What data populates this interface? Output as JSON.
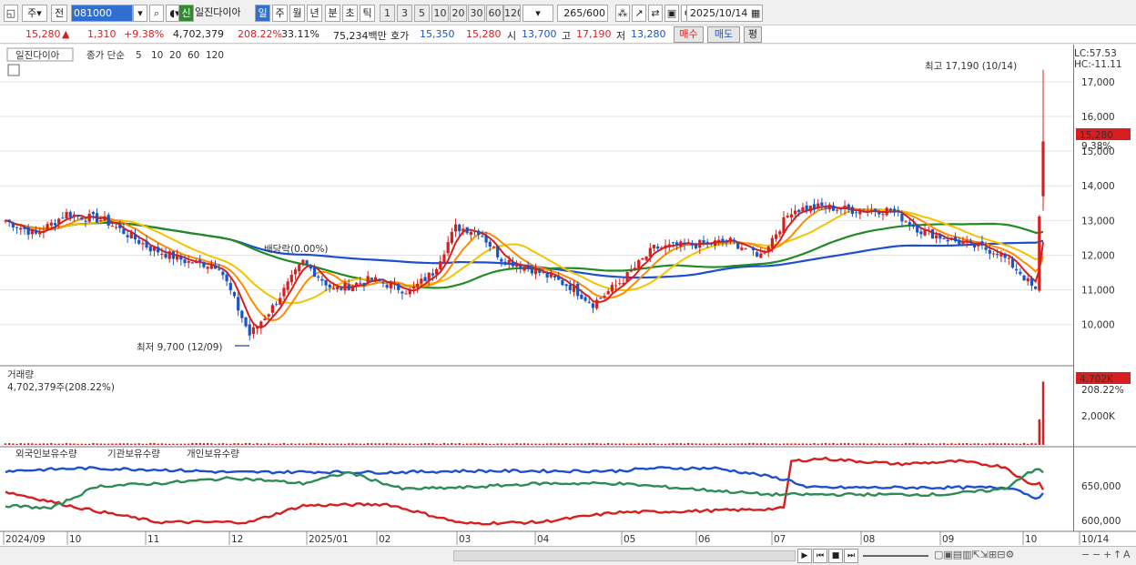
{
  "toolbar": {
    "market": "주",
    "prev": "전",
    "code": "081000",
    "name": "일진다이아",
    "periods": [
      "신",
      "일",
      "주",
      "월",
      "년",
      "분",
      "초",
      "틱"
    ],
    "active_period": "일",
    "intervals": [
      "1",
      "3",
      "5",
      "10",
      "20",
      "30",
      "60",
      "120"
    ],
    "count": "265",
    "total": "/600",
    "date": "2025/10/14"
  },
  "quote": {
    "price": "15,280",
    "arrow": "▲",
    "change": "1,310",
    "pct": "+9.38%",
    "volume": "4,702,379",
    "vol_ratio": "208.22%",
    "turnover": "33.11%",
    "amount": "75,234백만",
    "hoga_label": "호가",
    "hoga_sell": "15,350",
    "hoga_buy": "15,280",
    "open_label": "시",
    "open": "13,700",
    "high_label": "고",
    "high": "17,190",
    "low_label": "저",
    "low": "13,280",
    "buy_btn": "매수",
    "sell_btn": "매도",
    "eval_btn": "평"
  },
  "legend": {
    "name": "일진다이아",
    "ma_label": "종가 단순",
    "ma5": "5",
    "ma10": "10",
    "ma20": "20",
    "ma60": "60",
    "ma120": "120"
  },
  "annotations": {
    "high": "최고 17,190 (10/14)",
    "low": "최저 9,700 (12/09)",
    "dividend": "배당락(0.00%)",
    "lc": "LC:57.53",
    "hc": "HC:-11.11",
    "price_tag": "15,280",
    "price_pct": "9.38%"
  },
  "volume_panel": {
    "title": "거래량",
    "value": "4,702,379주(208.22%)",
    "tag": "4,702K",
    "tag_pct": "208.22%",
    "tick": "2,000K"
  },
  "holdings_panel": {
    "foreign": "외국인보유수량",
    "institution": "기관보유수량",
    "individual": "개인보유수량",
    "ticks": [
      "650,000",
      "600,000"
    ]
  },
  "x_labels": [
    "2024/09",
    "10",
    "11",
    "12",
    "2025/01",
    "02",
    "03",
    "04",
    "05",
    "06",
    "07",
    "08",
    "09",
    "10",
    "10/14"
  ],
  "chart_data": {
    "type": "candlestick",
    "y_ticks": [
      10000,
      11000,
      12000,
      13000,
      14000,
      15000,
      16000,
      17000
    ],
    "ylim": [
      9100,
      17600
    ],
    "anchors": [
      [
        0,
        13000
      ],
      [
        8,
        12600
      ],
      [
        16,
        13200
      ],
      [
        26,
        13000
      ],
      [
        38,
        12200
      ],
      [
        48,
        11800
      ],
      [
        56,
        11700
      ],
      [
        64,
        9700
      ],
      [
        70,
        10500
      ],
      [
        78,
        11800
      ],
      [
        86,
        11000
      ],
      [
        96,
        11300
      ],
      [
        106,
        10950
      ],
      [
        112,
        11500
      ],
      [
        118,
        12800
      ],
      [
        124,
        12700
      ],
      [
        130,
        11900
      ],
      [
        138,
        11600
      ],
      [
        148,
        11100
      ],
      [
        154,
        10600
      ],
      [
        162,
        11300
      ],
      [
        170,
        12200
      ],
      [
        180,
        12300
      ],
      [
        190,
        12400
      ],
      [
        198,
        12000
      ],
      [
        206,
        13300
      ],
      [
        214,
        13400
      ],
      [
        222,
        13300
      ],
      [
        232,
        13300
      ],
      [
        240,
        12700
      ],
      [
        246,
        12500
      ],
      [
        252,
        12300
      ],
      [
        260,
        12100
      ],
      [
        266,
        11500
      ],
      [
        270,
        10950
      ],
      [
        272,
        15280
      ]
    ],
    "ma5_last": 11800,
    "ma10_last": 11700,
    "ma20_last": 12000,
    "ma60_last": 12400,
    "ma120_last": 12400,
    "volume_last": 4702379,
    "volume_prev": 1900000,
    "foreign_anchors": [
      [
        0,
        530
      ],
      [
        20,
        470
      ],
      [
        40,
        420
      ],
      [
        64,
        420
      ],
      [
        78,
        480
      ],
      [
        100,
        485
      ],
      [
        120,
        415
      ],
      [
        140,
        420
      ],
      [
        160,
        455
      ],
      [
        180,
        460
      ],
      [
        195,
        465
      ],
      [
        204,
        470
      ],
      [
        206,
        640
      ],
      [
        214,
        650
      ],
      [
        234,
        630
      ],
      [
        250,
        640
      ],
      [
        262,
        620
      ],
      [
        268,
        560
      ],
      [
        271,
        560
      ],
      [
        272,
        540
      ]
    ],
    "institution_anchors": [
      [
        0,
        605
      ],
      [
        20,
        615
      ],
      [
        40,
        610
      ],
      [
        60,
        600
      ],
      [
        80,
        602
      ],
      [
        100,
        600
      ],
      [
        120,
        605
      ],
      [
        140,
        605
      ],
      [
        160,
        605
      ],
      [
        170,
        615
      ],
      [
        186,
        615
      ],
      [
        196,
        595
      ],
      [
        206,
        570
      ],
      [
        210,
        545
      ],
      [
        230,
        545
      ],
      [
        250,
        545
      ],
      [
        264,
        545
      ],
      [
        268,
        520
      ],
      [
        271,
        505
      ],
      [
        272,
        520
      ]
    ],
    "individual_anchors": [
      [
        0,
        480
      ],
      [
        12,
        470
      ],
      [
        24,
        550
      ],
      [
        40,
        560
      ],
      [
        60,
        580
      ],
      [
        78,
        560
      ],
      [
        90,
        600
      ],
      [
        104,
        540
      ],
      [
        120,
        545
      ],
      [
        140,
        560
      ],
      [
        160,
        560
      ],
      [
        180,
        540
      ],
      [
        200,
        520
      ],
      [
        210,
        520
      ],
      [
        230,
        520
      ],
      [
        246,
        520
      ],
      [
        262,
        540
      ],
      [
        268,
        600
      ],
      [
        271,
        610
      ],
      [
        272,
        600
      ]
    ]
  }
}
